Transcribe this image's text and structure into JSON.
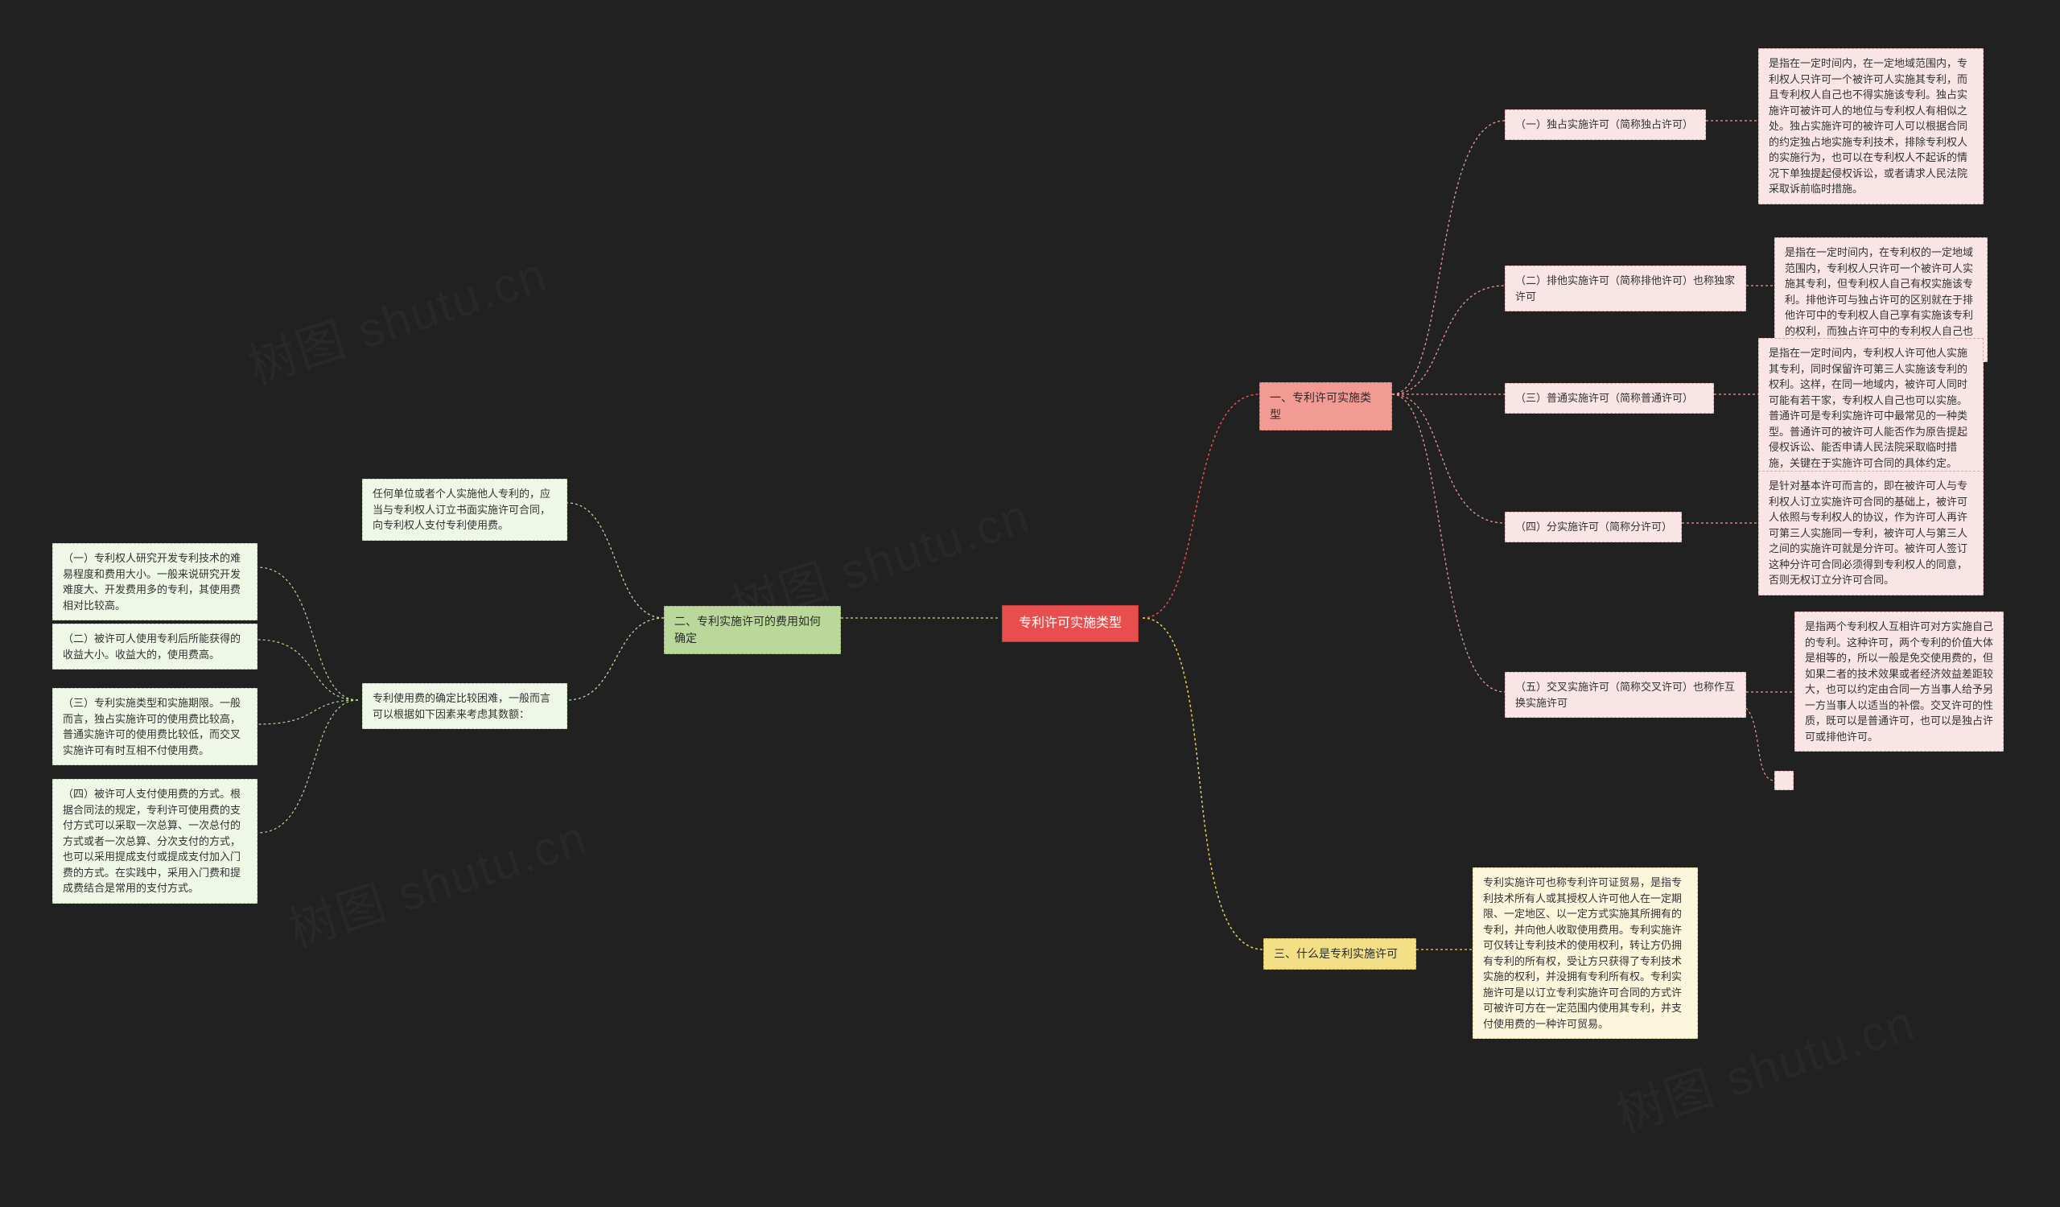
{
  "root": {
    "title": "专利许可实施类型"
  },
  "sec1": {
    "title": "一、专利许可实施类型",
    "items": [
      {
        "label": "（一）独占实施许可（简称独占许可）",
        "desc": "是指在一定时间内，在一定地域范围内，专利权人只许可一个被许可人实施其专利，而且专利权人自己也不得实施该专利。独占实施许可被许可人的地位与专利权人有相似之处。独占实施许可的被许可人可以根据合同的约定独占地实施专利技术，排除专利权人的实施行为，也可以在专利权人不起诉的情况下单独提起侵权诉讼，或者请求人民法院采取诉前临时措施。"
      },
      {
        "label": "（二）排他实施许可（简称排他许可）也称独家许可",
        "desc": "是指在一定时间内，在专利权的一定地域范围内，专利权人只许可一个被许可人实施其专利，但专利权人自己有权实施该专利。排他许可与独占许可的区别就在于排他许可中的专利权人自己享有实施该专利的权利，而独占许可中的专利权人自己也不能实施该专利。"
      },
      {
        "label": "（三）普通实施许可（简称普通许可）",
        "desc": "是指在一定时间内，专利权人许可他人实施其专利，同时保留许可第三人实施该专利的权利。这样，在同一地域内，被许可人同时可能有若干家，专利权人自己也可以实施。普通许可是专利实施许可中最常见的一种类型。普通许可的被许可人能否作为原告提起侵权诉讼、能否申请人民法院采取临时措施，关键在于实施许可合同的具体约定。"
      },
      {
        "label": "（四）分实施许可（简称分许可）",
        "desc": "是针对基本许可而言的，即在被许可人与专利权人订立实施许可合同的基础上，被许可人依照与专利权人的协议，作为许可人再许可第三人实施同一专利，被许可人与第三人之间的实施许可就是分许可。被许可人签订这种分许可合同必须得到专利权人的同意，否则无权订立分许可合同。"
      },
      {
        "label": "（五）交叉实施许可（简称交叉许可）也称作互换实施许可",
        "desc": "是指两个专利权人互相许可对方实施自己的专利。这种许可，两个专利的价值大体是相等的，所以一般是免交使用费的，但如果二者的技术效果或者经济效益差距较大，也可以约定由合同一方当事人给予另一方当事人以适当的补偿。交叉许可的性质，既可以是普通许可，也可以是独占许可或排他许可。",
        "extra": ""
      }
    ]
  },
  "sec2": {
    "title": "二、专利实施许可的费用如何确定",
    "p1": "任何单位或者个人实施他人专利的，应当与专利权人订立书面实施许可合同，向专利权人支付专利使用费。",
    "p2": "专利使用费的确定比较困难，一般而言可以根据如下因素来考虑其数额：",
    "factors": [
      "（一）专利权人研究开发专利技术的难易程度和费用大小。一般来说研究开发难度大、开发费用多的专利，其使用费相对比较高。",
      "（二）被许可人使用专利后所能获得的收益大小。收益大的，使用费高。",
      "（三）专利实施类型和实施期限。一般而言，独占实施许可的使用费比较高，普通实施许可的使用费比较低，而交叉实施许可有时互相不付使用费。",
      "（四）被许可人支付使用费的方式。根据合同法的规定，专利许可使用费的支付方式可以采取一次总算、一次总付的方式或者一次总算、分次支付的方式，也可以采用提成支付或提成支付加入门费的方式。在实践中，采用入门费和提成费结合是常用的支付方式。"
    ]
  },
  "sec3": {
    "title": "三、什么是专利实施许可",
    "desc": "专利实施许可也称专利许可证贸易，是指专利技术所有人或其授权人许可他人在一定期限、一定地区、以一定方式实施其所拥有的专利，并向他人收取使用费用。专利实施许可仅转让专利技术的使用权利，转让方仍拥有专利的所有权，受让方只获得了专利技术实施的权利，并没拥有专利所有权。专利实施许可是以订立专利实施许可合同的方式许可被许可方在一定范围内使用其专利，并支付使用费的一种许可贸易。"
  },
  "watermark": "树图 shutu.cn"
}
